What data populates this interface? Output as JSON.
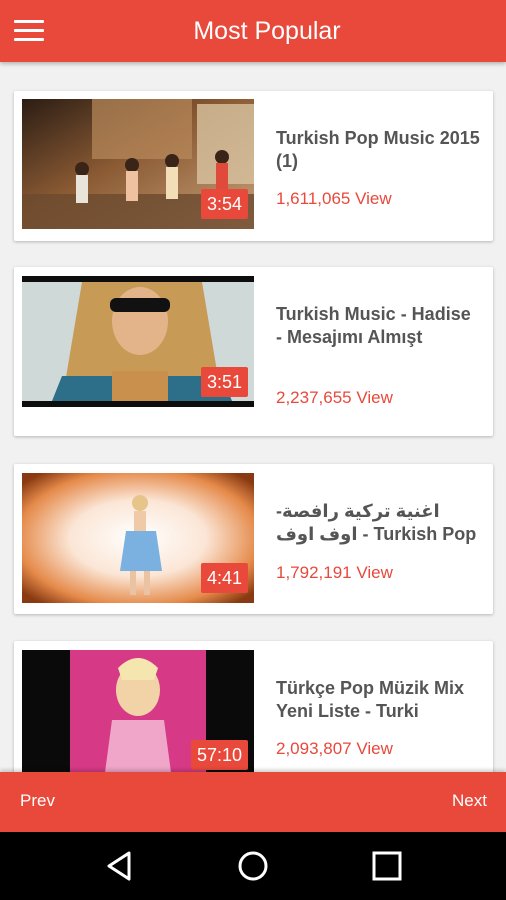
{
  "header": {
    "title": "Most Popular",
    "menu_icon": "hamburger-menu-icon"
  },
  "videos": [
    {
      "title": "Turkish Pop Music 2015 (1)",
      "views": "1,611,065 View",
      "duration": "3:54"
    },
    {
      "title": "Turkish Music - Hadise - Mesajımı Almışt",
      "views": "2,237,655 View",
      "duration": "3:51"
    },
    {
      "title": "اغنية تركية رافصة- اوف اوف - Turkish Pop",
      "views": "1,792,191 View",
      "duration": "4:41"
    },
    {
      "title": "Türkçe Pop Müzik Mix Yeni Liste - Turki",
      "views": "2,093,807 View",
      "duration": "57:10"
    }
  ],
  "footer": {
    "prev_label": "Prev",
    "next_label": "Next"
  },
  "system_nav": {
    "back_icon": "back-triangle-icon",
    "home_icon": "home-circle-icon",
    "recents_icon": "recents-square-icon"
  },
  "colors": {
    "accent": "#e8493b",
    "title_text": "#555555",
    "background": "#f1f1f1"
  }
}
